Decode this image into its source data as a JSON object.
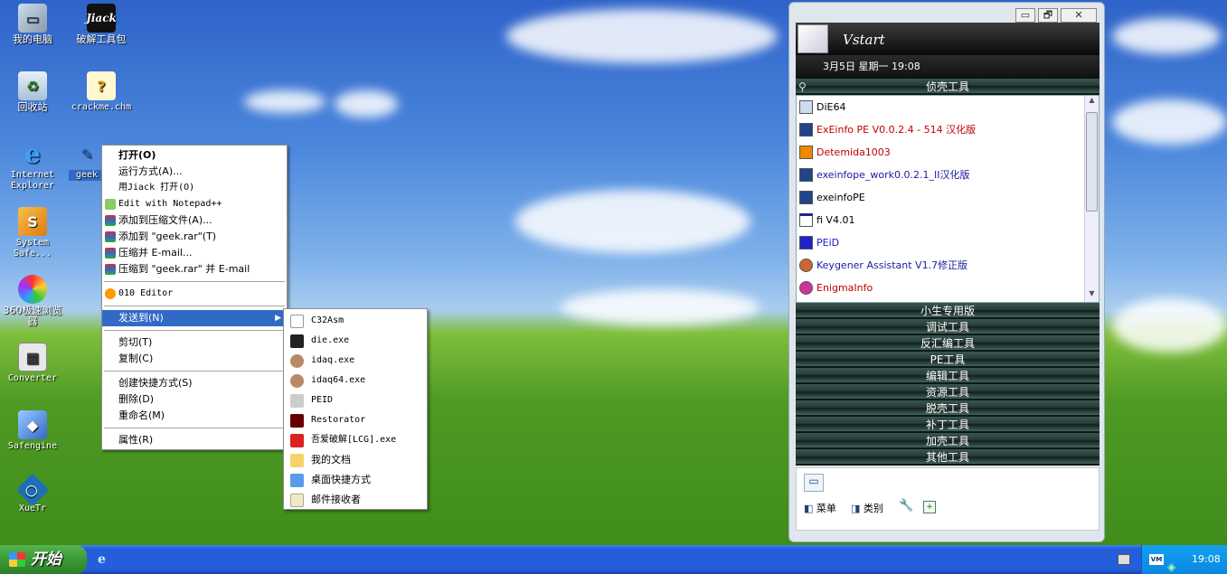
{
  "desktop": {
    "icons": [
      {
        "label": "我的电脑"
      },
      {
        "label": "破解工具包"
      },
      {
        "label": "回收站"
      },
      {
        "label": "crackme.chm"
      },
      {
        "label": "Internet Explorer"
      },
      {
        "label": "geek"
      },
      {
        "label": "System Safe..."
      },
      {
        "label": "360极速浏览器"
      },
      {
        "label": "Converter"
      },
      {
        "label": "Safengine"
      },
      {
        "label": "XueTr"
      }
    ],
    "jiack_logo": "Jiack"
  },
  "context_menu": {
    "items": [
      "打开(O)",
      "运行方式(A)...",
      "用Jiack  打开(O)",
      "Edit with Notepad++",
      "添加到压缩文件(A)...",
      "添加到 \"geek.rar\"(T)",
      "压缩并 E-mail...",
      "压缩到 \"geek.rar\" 并 E-mail",
      "010 Editor",
      "发送到(N)",
      "剪切(T)",
      "复制(C)",
      "创建快捷方式(S)",
      "删除(D)",
      "重命名(M)",
      "属性(R)"
    ],
    "arrow": "▶"
  },
  "sendto_menu": {
    "items": [
      "C32Asm",
      "die.exe",
      "idaq.exe",
      "idaq64.exe",
      "PEID",
      "Restorator",
      "吾爱破解[LCG].exe",
      "我的文档",
      "桌面快捷方式",
      "邮件接收者"
    ]
  },
  "vstart": {
    "title": "Vstart",
    "date": "3月5日 星期一 19:08",
    "window_buttons": [
      "▭",
      "🗗",
      "✕"
    ],
    "active_category": "侦壳工具",
    "tools": [
      {
        "name": "DiE64",
        "color": "#000000"
      },
      {
        "name": "ExEinfo PE V0.0.2.4 - 514 汉化版",
        "color": "#c00000"
      },
      {
        "name": "Detemida1003",
        "color": "#c00000"
      },
      {
        "name": "exeinfope_work0.0.2.1_II汉化版",
        "color": "#1a1aa0"
      },
      {
        "name": "exeinfoPE",
        "color": "#000000"
      },
      {
        "name": "fi V4.01",
        "color": "#000000"
      },
      {
        "name": "PEiD",
        "color": "#1a1ad0"
      },
      {
        "name": "Keygener Assistant V1.7修正版",
        "color": "#1a1aa0"
      },
      {
        "name": "EnigmaInfo",
        "color": "#c00000"
      }
    ],
    "categories": [
      "小生专用版",
      "调试工具",
      "反汇编工具",
      "PE工具",
      "编辑工具",
      "资源工具",
      "脱壳工具",
      "补丁工具",
      "加壳工具",
      "其他工具"
    ],
    "footer": {
      "menu": "菜单",
      "category": "类别"
    }
  },
  "taskbar": {
    "start_label": "开始",
    "clock": "19:08",
    "tray_vm": "VM"
  }
}
